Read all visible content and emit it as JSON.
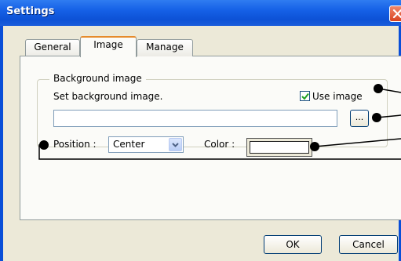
{
  "window": {
    "title": "Settings"
  },
  "tabs": [
    {
      "label": "General",
      "active": false
    },
    {
      "label": "Image",
      "active": true
    },
    {
      "label": "Manage",
      "active": false
    }
  ],
  "background_group": {
    "label": "Background image",
    "description": "Set background image.",
    "use_image_label": "Use image",
    "use_image_checked": true,
    "path_value": "",
    "browse_label": "..."
  },
  "position": {
    "label": "Position :",
    "selected": "Center"
  },
  "color": {
    "label": "Color :",
    "value": "#ffffff"
  },
  "buttons": {
    "ok": "OK",
    "cancel": "Cancel"
  },
  "colors": {
    "titlebar": "#1560e6",
    "frame": "#0a4fd8",
    "dialog_bg": "#ece9d8",
    "tab_active_accent": "#e68b2c"
  }
}
